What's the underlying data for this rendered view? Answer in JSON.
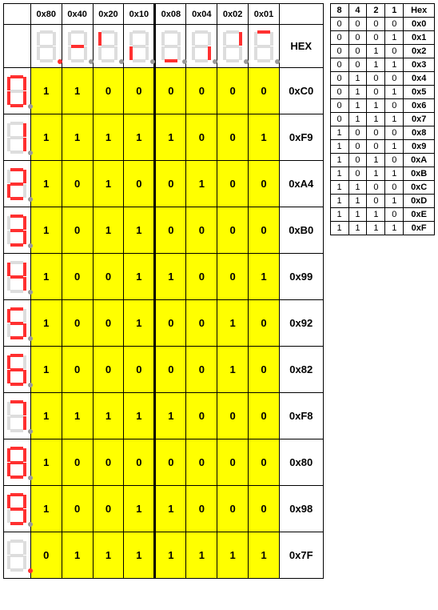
{
  "chart_data": {
    "type": "table",
    "bit_columns": [
      "0x80",
      "0x40",
      "0x20",
      "0x10",
      "0x08",
      "0x04",
      "0x02",
      "0x01"
    ],
    "hex_header": "HEX",
    "segment_headers": [
      "dp",
      "g",
      "f",
      "e",
      "d",
      "c",
      "b",
      "a"
    ],
    "rows": [
      {
        "digit": "0",
        "segments": "abcdef",
        "dp": false,
        "bits": [
          "1",
          "1",
          "0",
          "0",
          "0",
          "0",
          "0",
          "0"
        ],
        "hex": "0xC0"
      },
      {
        "digit": "1",
        "segments": "bc",
        "dp": false,
        "bits": [
          "1",
          "1",
          "1",
          "1",
          "1",
          "0",
          "0",
          "1"
        ],
        "hex": "0xF9"
      },
      {
        "digit": "2",
        "segments": "abged",
        "dp": false,
        "bits": [
          "1",
          "0",
          "1",
          "0",
          "0",
          "1",
          "0",
          "0"
        ],
        "hex": "0xA4"
      },
      {
        "digit": "3",
        "segments": "abgcd",
        "dp": false,
        "bits": [
          "1",
          "0",
          "1",
          "1",
          "0",
          "0",
          "0",
          "0"
        ],
        "hex": "0xB0"
      },
      {
        "digit": "4",
        "segments": "fgbc",
        "dp": false,
        "bits": [
          "1",
          "0",
          "0",
          "1",
          "1",
          "0",
          "0",
          "1"
        ],
        "hex": "0x99"
      },
      {
        "digit": "5",
        "segments": "afgcd",
        "dp": false,
        "bits": [
          "1",
          "0",
          "0",
          "1",
          "0",
          "0",
          "1",
          "0"
        ],
        "hex": "0x92"
      },
      {
        "digit": "6",
        "segments": "afgecd",
        "dp": false,
        "bits": [
          "1",
          "0",
          "0",
          "0",
          "0",
          "0",
          "1",
          "0"
        ],
        "hex": "0x82"
      },
      {
        "digit": "7",
        "segments": "abc",
        "dp": false,
        "bits": [
          "1",
          "1",
          "1",
          "1",
          "1",
          "0",
          "0",
          "0"
        ],
        "hex": "0xF8"
      },
      {
        "digit": "8",
        "segments": "abcdefg",
        "dp": false,
        "bits": [
          "1",
          "0",
          "0",
          "0",
          "0",
          "0",
          "0",
          "0"
        ],
        "hex": "0x80"
      },
      {
        "digit": "9",
        "segments": "abcfgd",
        "dp": false,
        "bits": [
          "1",
          "0",
          "0",
          "1",
          "1",
          "0",
          "0",
          "0"
        ],
        "hex": "0x98"
      },
      {
        "digit": "dp",
        "segments": "",
        "dp": true,
        "bits": [
          "0",
          "1",
          "1",
          "1",
          "1",
          "1",
          "1",
          "1"
        ],
        "hex": "0x7F"
      }
    ],
    "mini_table": {
      "cols": [
        "8",
        "4",
        "2",
        "1",
        "Hex"
      ],
      "rows": [
        [
          "0",
          "0",
          "0",
          "0",
          "0x0"
        ],
        [
          "0",
          "0",
          "0",
          "1",
          "0x1"
        ],
        [
          "0",
          "0",
          "1",
          "0",
          "0x2"
        ],
        [
          "0",
          "0",
          "1",
          "1",
          "0x3"
        ],
        [
          "0",
          "1",
          "0",
          "0",
          "0x4"
        ],
        [
          "0",
          "1",
          "0",
          "1",
          "0x5"
        ],
        [
          "0",
          "1",
          "1",
          "0",
          "0x6"
        ],
        [
          "0",
          "1",
          "1",
          "1",
          "0x7"
        ],
        [
          "1",
          "0",
          "0",
          "0",
          "0x8"
        ],
        [
          "1",
          "0",
          "0",
          "1",
          "0x9"
        ],
        [
          "1",
          "0",
          "1",
          "0",
          "0xA"
        ],
        [
          "1",
          "0",
          "1",
          "1",
          "0xB"
        ],
        [
          "1",
          "1",
          "0",
          "0",
          "0xC"
        ],
        [
          "1",
          "1",
          "0",
          "1",
          "0xD"
        ],
        [
          "1",
          "1",
          "1",
          "0",
          "0xE"
        ],
        [
          "1",
          "1",
          "1",
          "1",
          "0xF"
        ]
      ]
    }
  }
}
